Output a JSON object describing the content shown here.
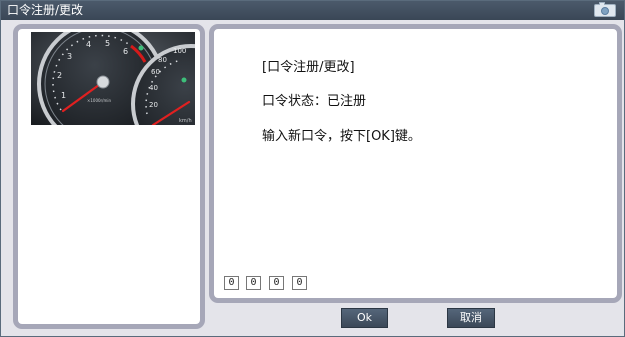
{
  "window": {
    "title": "口令注册/更改"
  },
  "icons": {
    "titlebar_icon": "camera-icon",
    "panel_image": "speedometer-gauge-photo"
  },
  "dialog": {
    "heading": "[口令注册/更改]",
    "status_line": "口令状态：已注册",
    "instruction": "输入新口令，按下[OK]键。"
  },
  "password": {
    "digits": [
      "0",
      "0",
      "0",
      "0"
    ]
  },
  "buttons": {
    "ok": "Ok",
    "cancel": "取消"
  },
  "gauge": {
    "tach_labels": [
      "1",
      "2",
      "3",
      "4",
      "5",
      "6"
    ],
    "speed_labels": [
      "20",
      "40",
      "60",
      "80",
      "100"
    ],
    "tach_unit": "×1000r/min",
    "speed_unit": "km/h"
  },
  "colors": {
    "titlebar": "#3f4c5b",
    "panel_border": "#a6a7b8",
    "window_bg": "#e4e4ea",
    "button_bg": "#46556a",
    "needle": "#d01818"
  }
}
